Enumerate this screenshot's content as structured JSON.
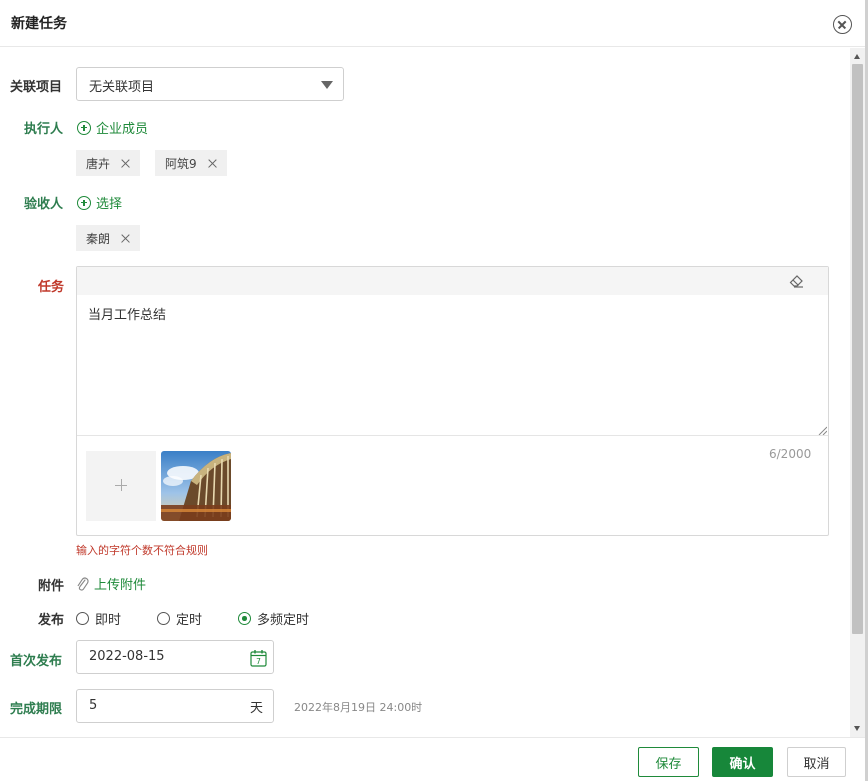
{
  "dialog": {
    "title": "新建任务"
  },
  "form": {
    "project": {
      "label": "关联项目",
      "value": "无关联项目"
    },
    "assignee": {
      "label": "执行人",
      "add_label": "企业成员",
      "tags": [
        "唐卉",
        "阿筑9"
      ]
    },
    "reviewer": {
      "label": "验收人",
      "add_label": "选择",
      "tags": [
        "秦朗"
      ]
    },
    "task": {
      "label": "任务",
      "text": "当月工作总结",
      "char_count": "6/2000",
      "error": "输入的字符个数不符合规则"
    },
    "attachment": {
      "label": "附件",
      "link_label": "上传附件"
    },
    "publish": {
      "label": "发布",
      "options": [
        "即时",
        "定时",
        "多频定时"
      ],
      "selected_index": 2
    },
    "first_publish": {
      "label": "首次发布",
      "value": "2022-08-15",
      "calendar_day": "7"
    },
    "deadline": {
      "label": "完成期限",
      "value": "5",
      "unit": "天",
      "hint": "2022年8月19日 24:00时"
    }
  },
  "footer": {
    "save_label": "保存",
    "confirm_label": "确认",
    "cancel_label": "取消"
  },
  "colors": {
    "accent": "#1f8a3a",
    "error": "#c0392b",
    "label_green": "#2e7d4f"
  }
}
